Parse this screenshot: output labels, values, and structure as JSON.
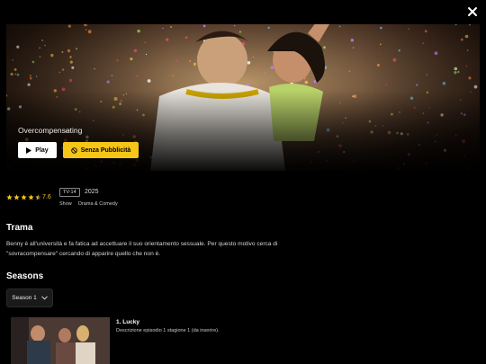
{
  "modal": {
    "close_icon": "close-icon"
  },
  "hero": {
    "title": "Overcompensating",
    "play_label": "Play",
    "play_icon": "play-icon",
    "ad_free_label": "Senza Pubblicità",
    "ad_free_icon": "no-ads-icon",
    "accent_color": "#f5c518"
  },
  "meta": {
    "stars": 4.5,
    "stars_max": 5,
    "rating": "7.6",
    "tv_rating": "TV-14",
    "year": "2025",
    "type_label": "Show",
    "genre": "Drama & Comedy"
  },
  "plot": {
    "heading": "Trama",
    "text": "Benny è all'università e fa fatica ad accettuare il suo orientamento sessuale. Per questo motivo cerca di \"sovracompensare\" cercando di apparire quello che non è."
  },
  "seasons": {
    "heading": "Seasons",
    "selected": "Season 1",
    "chevron_icon": "chevron-down-icon"
  },
  "episodes": [
    {
      "title": "1. Lucky",
      "description": "Descrizione episodio 1 stagione 1 (da inserire)."
    }
  ]
}
